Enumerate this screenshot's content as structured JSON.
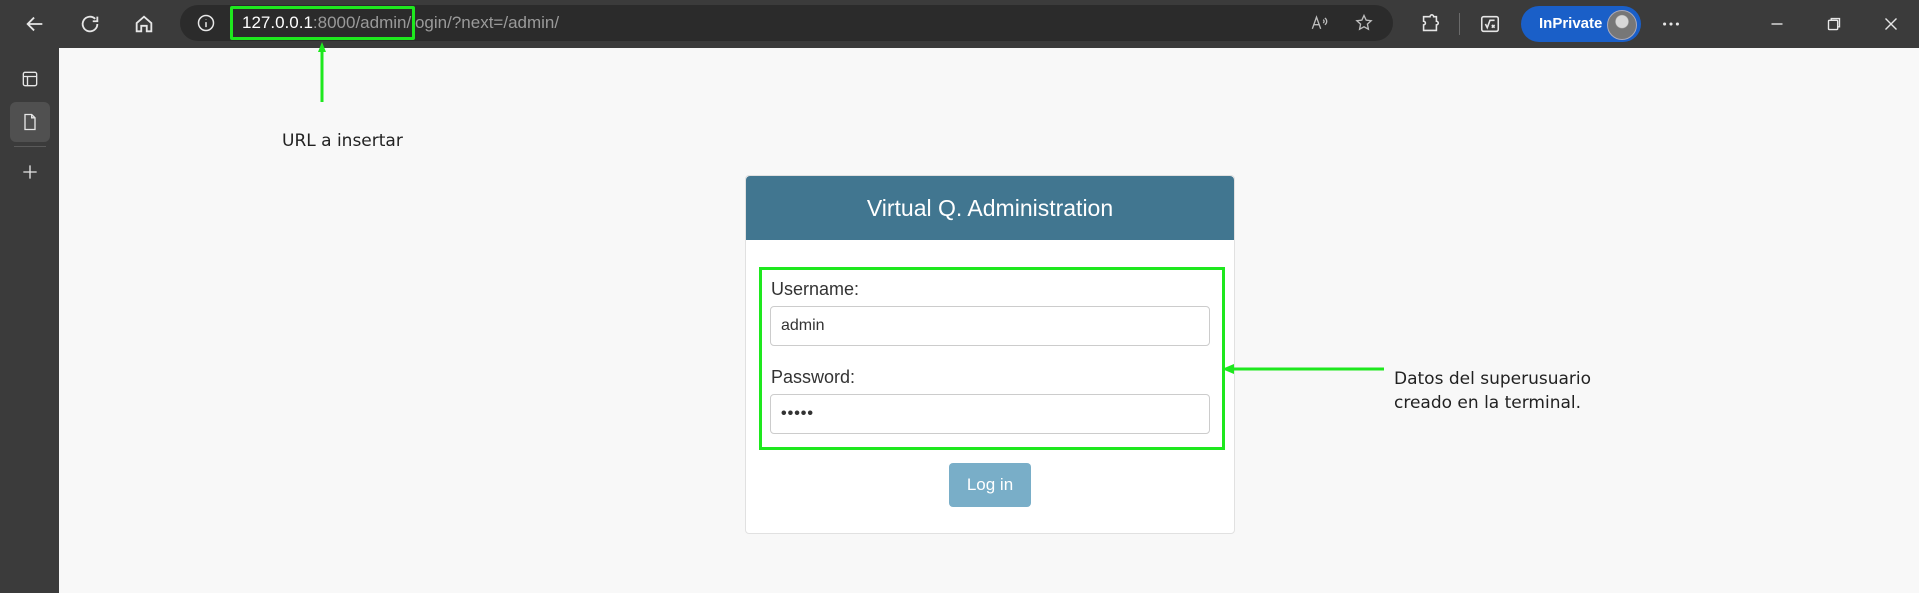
{
  "browser": {
    "address": {
      "host": "127.0.0.1",
      "rest": ":8000/admin/login/?next=/admin/"
    },
    "profile_label": "InPrivate"
  },
  "annotations": {
    "url_note": "URL a insertar",
    "data_note_line1": "Datos del superusuario",
    "data_note_line2": "creado en la terminal.",
    "highlight_color": "#1ee81e"
  },
  "login": {
    "title": "Virtual Q. Administration",
    "username_label": "Username:",
    "username_value": "admin",
    "password_label": "Password:",
    "password_value": "•••••",
    "submit_label": "Log in",
    "header_color": "#417690",
    "button_color": "#79aec8"
  }
}
